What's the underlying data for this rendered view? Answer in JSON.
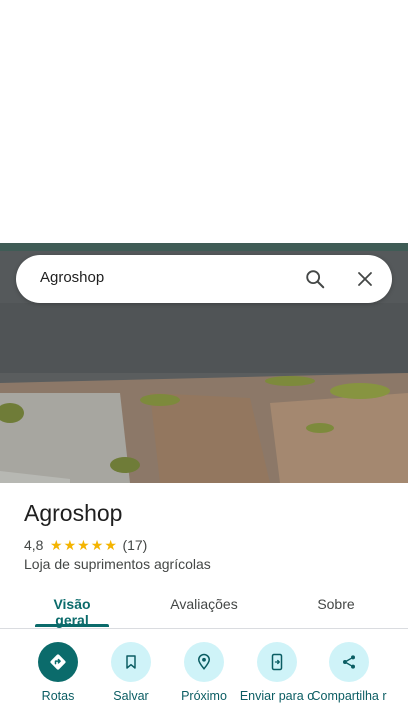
{
  "search": {
    "query": "Agroshop",
    "search_icon": "search-icon",
    "close_icon": "close-icon"
  },
  "place": {
    "name": "Agroshop",
    "rating": "4,8",
    "stars": [
      "★",
      "★",
      "★",
      "★",
      "★"
    ],
    "review_count": "(17)",
    "category": "Loja de suprimentos agrícolas"
  },
  "tabs": [
    {
      "label": "Visão geral",
      "active": true
    },
    {
      "label": "Avaliações",
      "active": false
    },
    {
      "label": "Sobre",
      "active": false
    }
  ],
  "actions": [
    {
      "label": "Rotas",
      "icon": "directions-icon"
    },
    {
      "label": "Salvar",
      "icon": "bookmark-icon"
    },
    {
      "label": "Próximo",
      "icon": "nearby-icon"
    },
    {
      "label": "Enviar para o",
      "icon": "send-to-phone-icon"
    },
    {
      "label": "Compartilha r",
      "icon": "share-icon"
    }
  ],
  "colors": {
    "accent": "#0b6b6b",
    "star": "#f4b400",
    "action_bg": "#cff3f8"
  }
}
